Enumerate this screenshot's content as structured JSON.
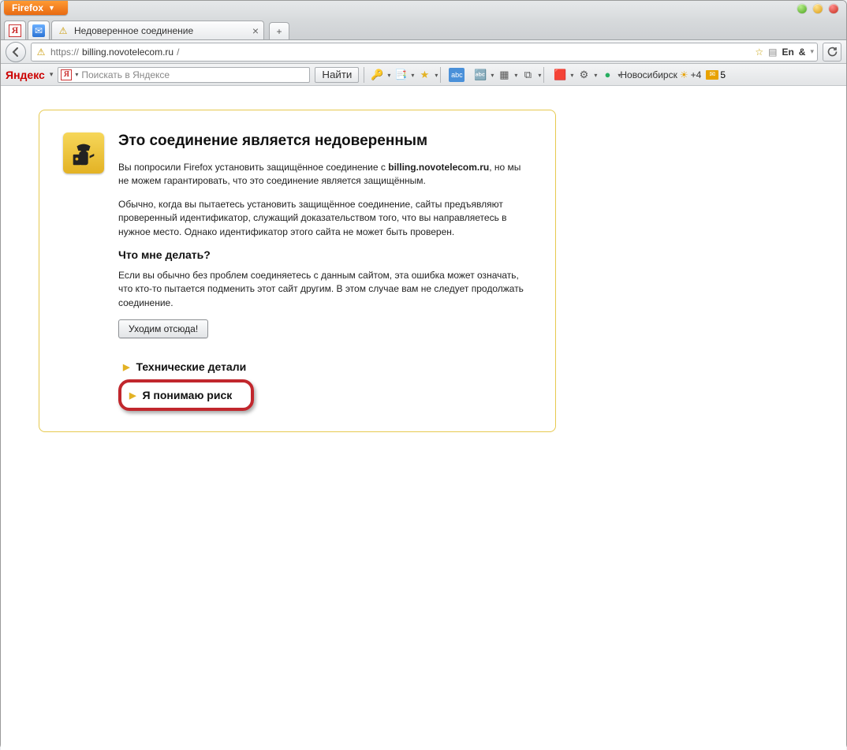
{
  "browser": {
    "app_button": "Firefox",
    "pinned_tabs": [
      "yandex",
      "mail"
    ],
    "active_tab": {
      "title": "Недоверенное соединение",
      "icon": "warning"
    },
    "url_scheme": "https://",
    "url_host": "billing.novotelecom.ru",
    "url_path": "/",
    "locale_indicator": "En",
    "rss_indicator": "ℝ"
  },
  "yandex_bar": {
    "label": "Яндекс",
    "search_placeholder": "Поискать в Яндексе",
    "search_button": "Найти",
    "city": "Новосибирск",
    "weather_temp": "+4",
    "mail_count": "5"
  },
  "error_page": {
    "heading": "Это соединение является недоверенным",
    "p1_a": "Вы попросили Firefox установить защищённое соединение с ",
    "p1_host": "billing.novotelecom.ru",
    "p1_b": ", но мы не можем гарантировать, что это соединение является защищённым.",
    "p2": "Обычно, когда вы пытаетесь установить защищённое соединение, сайты предъявляют проверенный идентификатор, служащий доказательством того, что вы направляетесь в нужное место. Однако идентификатор этого сайта не может быть проверен.",
    "sub_heading": "Что мне делать?",
    "p3": "Если вы обычно без проблем соединяетесь с данным сайтом, эта ошибка может означать, что кто-то пытается подменить этот сайт другим. В этом случае вам не следует продолжать соединение.",
    "leave_button": "Уходим отсюда!",
    "expander_tech": "Технические детали",
    "expander_risk": "Я понимаю риск"
  }
}
